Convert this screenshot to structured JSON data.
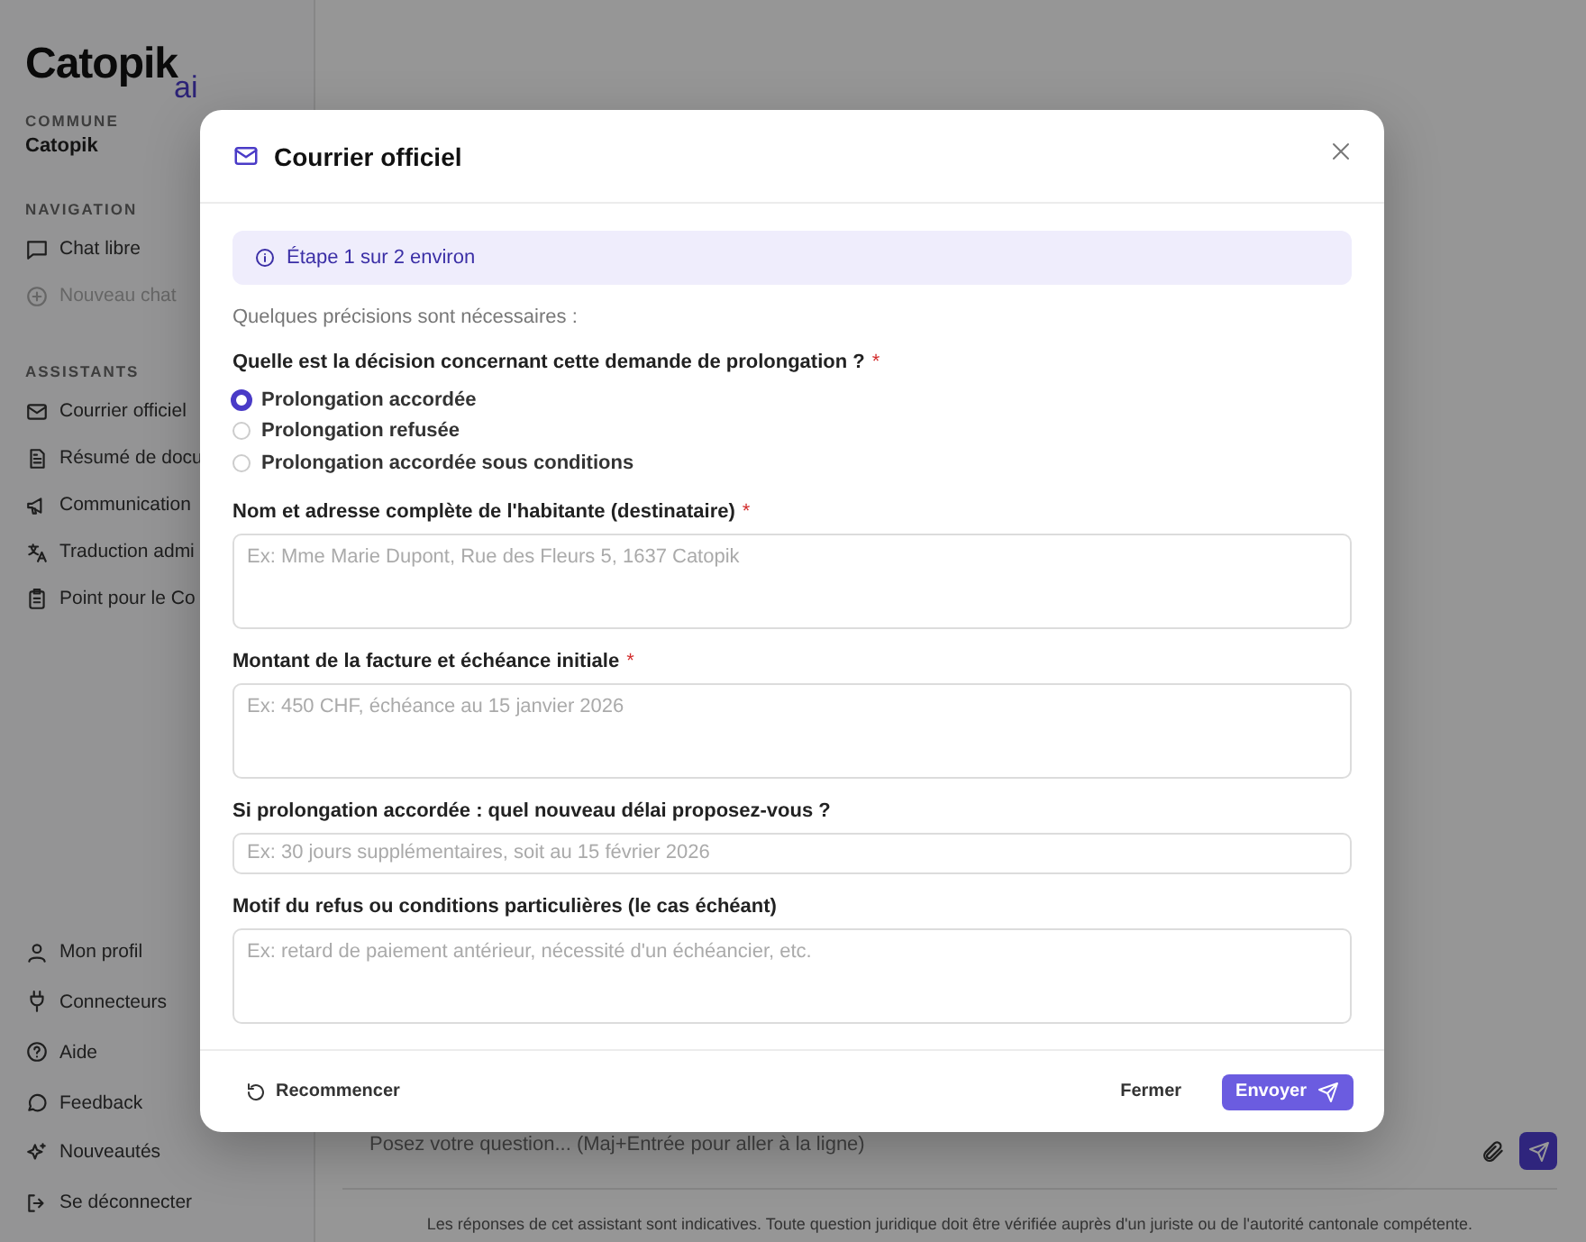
{
  "brand": {
    "name": "Catopik",
    "suffix": "ai"
  },
  "sidebar": {
    "commune_label": "COMMUNE",
    "commune": "Catopik",
    "sections": [
      {
        "title": "NAVIGATION",
        "items": [
          {
            "label": "Chat libre",
            "kind": "chat",
            "disabled": false
          },
          {
            "label": "Nouveau chat",
            "kind": "plus",
            "disabled": true
          }
        ]
      },
      {
        "title": "ASSISTANTS",
        "items": [
          {
            "label": "Courrier officiel",
            "kind": "mail",
            "disabled": false
          },
          {
            "label": "Résumé de docu",
            "kind": "document",
            "disabled": false
          },
          {
            "label": "Communication",
            "kind": "megaphone",
            "disabled": false
          },
          {
            "label": "Traduction admi",
            "kind": "translate",
            "disabled": false
          },
          {
            "label": "Point pour le Co",
            "kind": "clipboard",
            "disabled": false
          }
        ]
      }
    ],
    "bottom_items": [
      {
        "label": "Mon profil",
        "kind": "user"
      },
      {
        "label": "Connecteurs",
        "kind": "plug"
      },
      {
        "label": "Aide",
        "kind": "help"
      },
      {
        "label": "Feedback",
        "kind": "chat-round"
      },
      {
        "label": "Nouveautés",
        "kind": "sparkles"
      },
      {
        "label": "Se déconnecter",
        "kind": "logout"
      }
    ]
  },
  "chat": {
    "placeholder": "Posez votre question... (Maj+Entrée pour aller à la ligne)",
    "disclaimer": "Les réponses de cet assistant sont indicatives. Toute question juridique doit être vérifiée auprès d'un juriste ou de l'autorité cantonale compétente."
  },
  "dialog": {
    "title": "Courrier officiel",
    "step": "Étape 1 sur 2 environ",
    "intro": "Quelques précisions sont nécessaires :",
    "questions": [
      {
        "kind": "radio",
        "label": "Quelle est la décision concernant cette demande de prolongation ?",
        "required_mark": "*",
        "options": [
          {
            "label": "Prolongation accordée",
            "selected": true
          },
          {
            "label": "Prolongation refusée",
            "selected": false
          },
          {
            "label": "Prolongation accordée sous conditions",
            "selected": false
          }
        ]
      },
      {
        "kind": "textarea",
        "label": "Nom et adresse complète de l'habitante (destinataire)",
        "required_mark": "*",
        "placeholder": "Ex: Mme Marie Dupont, Rue des Fleurs 5, 1637 Catopik"
      },
      {
        "kind": "textarea",
        "label": "Montant de la facture et échéance initiale",
        "required_mark": "*",
        "placeholder": "Ex: 450 CHF, échéance au 15 janvier 2026"
      },
      {
        "kind": "input",
        "label": "Si prolongation accordée : quel nouveau délai proposez-vous ?",
        "placeholder": "Ex: 30 jours supplémentaires, soit au 15 février 2026"
      },
      {
        "kind": "textarea",
        "label": "Motif du refus ou conditions particulières (le cas échéant)",
        "placeholder": "Ex: retard de paiement antérieur, nécessité d'un échéancier, etc."
      }
    ],
    "footer": {
      "restart": "Recommencer",
      "close": "Fermer",
      "send": "Envoyer"
    }
  }
}
